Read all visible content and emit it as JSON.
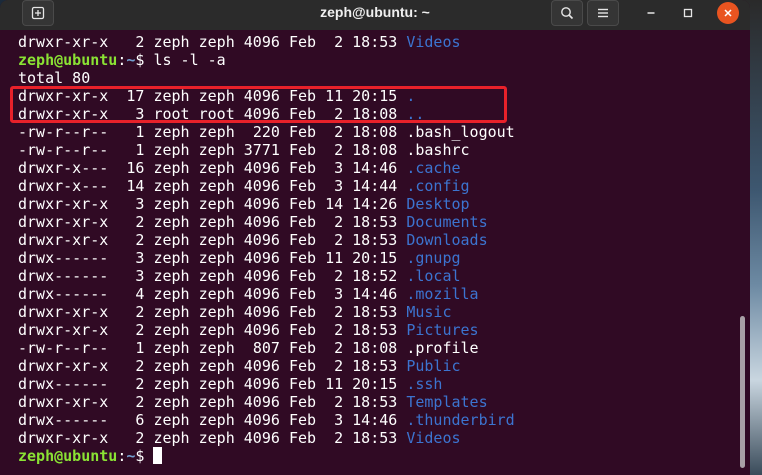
{
  "window": {
    "title": "zeph@ubuntu: ~",
    "icons": {
      "new_tab": "plus-in-box-icon",
      "search": "search-icon",
      "menu": "hamburger-menu-icon",
      "minimize": "minimize-icon",
      "maximize": "maximize-icon",
      "close": "close-icon"
    }
  },
  "terminal": {
    "prev_line": {
      "perms": "drwxr-xr-x",
      "links": "2",
      "owner": "zeph",
      "group": "zeph",
      "size": "4096",
      "month": "Feb",
      "day": "2",
      "time": "18:53",
      "name": "Videos",
      "is_dir": true
    },
    "prompt": {
      "user_host": "zeph@ubuntu",
      "sep": ":",
      "path": "~",
      "symbol": "$",
      "command": "ls -l -a"
    },
    "total": "total 80",
    "entries": [
      {
        "perms": "drwxr-xr-x",
        "links": "17",
        "owner": "zeph",
        "group": "zeph",
        "size": "4096",
        "month": "Feb",
        "day": "11",
        "time": "20:15",
        "name": ".",
        "is_dir": true
      },
      {
        "perms": "drwxr-xr-x",
        "links": "3",
        "owner": "root",
        "group": "root",
        "size": "4096",
        "month": "Feb",
        "day": "2",
        "time": "18:08",
        "name": "..",
        "is_dir": true
      },
      {
        "perms": "-rw-r--r--",
        "links": "1",
        "owner": "zeph",
        "group": "zeph",
        "size": "220",
        "month": "Feb",
        "day": "2",
        "time": "18:08",
        "name": ".bash_logout",
        "is_dir": false
      },
      {
        "perms": "-rw-r--r--",
        "links": "1",
        "owner": "zeph",
        "group": "zeph",
        "size": "3771",
        "month": "Feb",
        "day": "2",
        "time": "18:08",
        "name": ".bashrc",
        "is_dir": false
      },
      {
        "perms": "drwxr-x---",
        "links": "16",
        "owner": "zeph",
        "group": "zeph",
        "size": "4096",
        "month": "Feb",
        "day": "3",
        "time": "14:46",
        "name": ".cache",
        "is_dir": true
      },
      {
        "perms": "drwxr-x---",
        "links": "14",
        "owner": "zeph",
        "group": "zeph",
        "size": "4096",
        "month": "Feb",
        "day": "3",
        "time": "14:44",
        "name": ".config",
        "is_dir": true
      },
      {
        "perms": "drwxr-xr-x",
        "links": "3",
        "owner": "zeph",
        "group": "zeph",
        "size": "4096",
        "month": "Feb",
        "day": "14",
        "time": "14:26",
        "name": "Desktop",
        "is_dir": true
      },
      {
        "perms": "drwxr-xr-x",
        "links": "2",
        "owner": "zeph",
        "group": "zeph",
        "size": "4096",
        "month": "Feb",
        "day": "2",
        "time": "18:53",
        "name": "Documents",
        "is_dir": true
      },
      {
        "perms": "drwxr-xr-x",
        "links": "2",
        "owner": "zeph",
        "group": "zeph",
        "size": "4096",
        "month": "Feb",
        "day": "2",
        "time": "18:53",
        "name": "Downloads",
        "is_dir": true
      },
      {
        "perms": "drwx------",
        "links": "3",
        "owner": "zeph",
        "group": "zeph",
        "size": "4096",
        "month": "Feb",
        "day": "11",
        "time": "20:15",
        "name": ".gnupg",
        "is_dir": true
      },
      {
        "perms": "drwx------",
        "links": "3",
        "owner": "zeph",
        "group": "zeph",
        "size": "4096",
        "month": "Feb",
        "day": "2",
        "time": "18:52",
        "name": ".local",
        "is_dir": true
      },
      {
        "perms": "drwx------",
        "links": "4",
        "owner": "zeph",
        "group": "zeph",
        "size": "4096",
        "month": "Feb",
        "day": "3",
        "time": "14:46",
        "name": ".mozilla",
        "is_dir": true
      },
      {
        "perms": "drwxr-xr-x",
        "links": "2",
        "owner": "zeph",
        "group": "zeph",
        "size": "4096",
        "month": "Feb",
        "day": "2",
        "time": "18:53",
        "name": "Music",
        "is_dir": true
      },
      {
        "perms": "drwxr-xr-x",
        "links": "2",
        "owner": "zeph",
        "group": "zeph",
        "size": "4096",
        "month": "Feb",
        "day": "2",
        "time": "18:53",
        "name": "Pictures",
        "is_dir": true
      },
      {
        "perms": "-rw-r--r--",
        "links": "1",
        "owner": "zeph",
        "group": "zeph",
        "size": "807",
        "month": "Feb",
        "day": "2",
        "time": "18:08",
        "name": ".profile",
        "is_dir": false
      },
      {
        "perms": "drwxr-xr-x",
        "links": "2",
        "owner": "zeph",
        "group": "zeph",
        "size": "4096",
        "month": "Feb",
        "day": "2",
        "time": "18:53",
        "name": "Public",
        "is_dir": true
      },
      {
        "perms": "drwx------",
        "links": "2",
        "owner": "zeph",
        "group": "zeph",
        "size": "4096",
        "month": "Feb",
        "day": "11",
        "time": "20:15",
        "name": ".ssh",
        "is_dir": true
      },
      {
        "perms": "drwxr-xr-x",
        "links": "2",
        "owner": "zeph",
        "group": "zeph",
        "size": "4096",
        "month": "Feb",
        "day": "2",
        "time": "18:53",
        "name": "Templates",
        "is_dir": true
      },
      {
        "perms": "drwx------",
        "links": "6",
        "owner": "zeph",
        "group": "zeph",
        "size": "4096",
        "month": "Feb",
        "day": "3",
        "time": "14:46",
        "name": ".thunderbird",
        "is_dir": true
      },
      {
        "perms": "drwxr-xr-x",
        "links": "2",
        "owner": "zeph",
        "group": "zeph",
        "size": "4096",
        "month": "Feb",
        "day": "2",
        "time": "18:53",
        "name": "Videos",
        "is_dir": true
      }
    ],
    "final_prompt": {
      "user_host": "zeph@ubuntu",
      "sep": ":",
      "path": "~",
      "symbol": "$"
    }
  },
  "colors": {
    "terminal_bg": "#300a24",
    "directory": "#3c74d0",
    "prompt_user": "#8ae234",
    "prompt_path": "#729fcf",
    "highlight": "#e8212a"
  }
}
